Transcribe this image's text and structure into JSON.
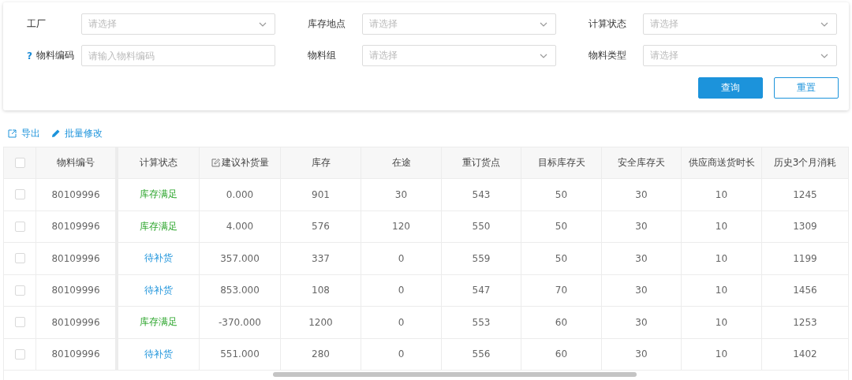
{
  "filters": [
    {
      "label": "工厂",
      "kind": "select",
      "placeholder": "请选择"
    },
    {
      "label": "库存地点",
      "kind": "select",
      "placeholder": "请选择"
    },
    {
      "label": "计算状态",
      "kind": "select",
      "placeholder": "请选择"
    },
    {
      "help": "?",
      "label": "物料编码",
      "kind": "input",
      "placeholder": "请输入物料编码"
    },
    {
      "label": "物料组",
      "kind": "select",
      "placeholder": "请选择"
    },
    {
      "label": "物料类型",
      "kind": "select",
      "placeholder": "请选择"
    }
  ],
  "buttons": [
    {
      "label": "查询",
      "kind": "primary"
    },
    {
      "label": "重置",
      "kind": "secondary"
    }
  ],
  "toolbar": [
    {
      "label": "导出",
      "kind": "export"
    },
    {
      "label": "批量修改",
      "kind": "edit"
    }
  ],
  "table": {
    "select_all": {
      "checked": false
    },
    "columns": [
      {
        "label": "物料编号",
        "kind": "plain"
      },
      {
        "label": "计算状态",
        "kind": "plain"
      },
      {
        "label": "建议补货量",
        "kind": "editable"
      },
      {
        "label": "库存",
        "kind": "plain"
      },
      {
        "label": "在途",
        "kind": "plain"
      },
      {
        "label": "重订货点",
        "kind": "plain"
      },
      {
        "label": "目标库存天",
        "kind": "plain"
      },
      {
        "label": "安全库存天",
        "kind": "plain"
      },
      {
        "label": "供应商送货时长",
        "kind": "plain"
      },
      {
        "label": "历史3个月消耗",
        "kind": "plain"
      }
    ],
    "rows": [
      {
        "checked": false,
        "kind": "ok",
        "cells": [
          "80109996",
          "库存满足",
          "0.000",
          "901",
          "30",
          "543",
          "50",
          "30",
          "10",
          "1245"
        ]
      },
      {
        "checked": false,
        "kind": "ok",
        "cells": [
          "80109996",
          "库存满足",
          "4.000",
          "576",
          "120",
          "550",
          "50",
          "30",
          "10",
          "1309"
        ]
      },
      {
        "checked": false,
        "kind": "pending",
        "cells": [
          "80109996",
          "待补货",
          "357.000",
          "337",
          "0",
          "559",
          "50",
          "30",
          "10",
          "1199"
        ]
      },
      {
        "checked": false,
        "kind": "pending",
        "cells": [
          "80109996",
          "待补货",
          "853.000",
          "108",
          "0",
          "547",
          "70",
          "30",
          "10",
          "1456"
        ]
      },
      {
        "checked": false,
        "kind": "ok",
        "cells": [
          "80109996",
          "库存满足",
          "-370.000",
          "1200",
          "0",
          "553",
          "60",
          "30",
          "10",
          "1253"
        ]
      },
      {
        "checked": false,
        "kind": "pending",
        "cells": [
          "80109996",
          "待补货",
          "551.000",
          "280",
          "0",
          "556",
          "60",
          "30",
          "10",
          "1402"
        ]
      }
    ]
  }
}
